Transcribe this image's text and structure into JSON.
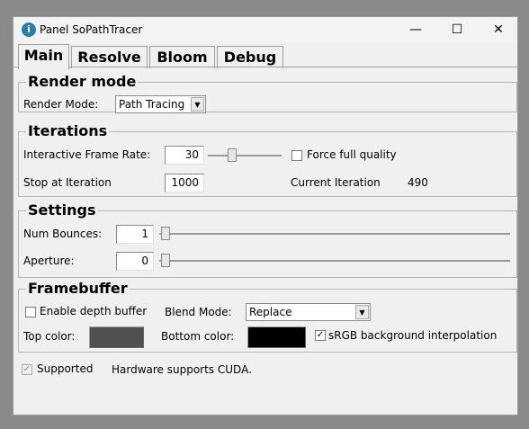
{
  "window": {
    "title": "Panel SoPathTracer",
    "minimize": "—",
    "maximize": "☐",
    "close": "✕"
  },
  "tabs": [
    {
      "label": "Main",
      "selected": true
    },
    {
      "label": "Resolve"
    },
    {
      "label": "Bloom"
    },
    {
      "label": "Debug"
    }
  ],
  "render_mode": {
    "title": "Render mode",
    "label": "Render Mode:",
    "value": "Path Tracing"
  },
  "iterations": {
    "title": "Iterations",
    "frame_rate_label": "Interactive Frame Rate:",
    "frame_rate": "30",
    "frame_rate_slider_fraction": 0.3,
    "force_full_quality": "Force full quality",
    "force_full_quality_checked": false,
    "stop_label": "Stop at Iteration",
    "stop_value": "1000",
    "current_label": "Current Iteration",
    "current_value": "490"
  },
  "settings": {
    "title": "Settings",
    "bounces_label": "Num Bounces:",
    "bounces": "1",
    "aperture_label": "Aperture:",
    "aperture": "0"
  },
  "framebuffer": {
    "title": "Framebuffer",
    "depth_label": "Enable depth buffer",
    "depth_checked": false,
    "blend_label": "Blend Mode:",
    "blend_value": "Replace",
    "top_label": "Top color:",
    "top_color": "#505050",
    "bottom_label": "Bottom color:",
    "bottom_color": "#000000",
    "srgb_label": "sRGB background interpolation",
    "srgb_checked": true
  },
  "status": {
    "supported_label": "Supported",
    "supported_checked": true,
    "message": "Hardware supports CUDA."
  }
}
